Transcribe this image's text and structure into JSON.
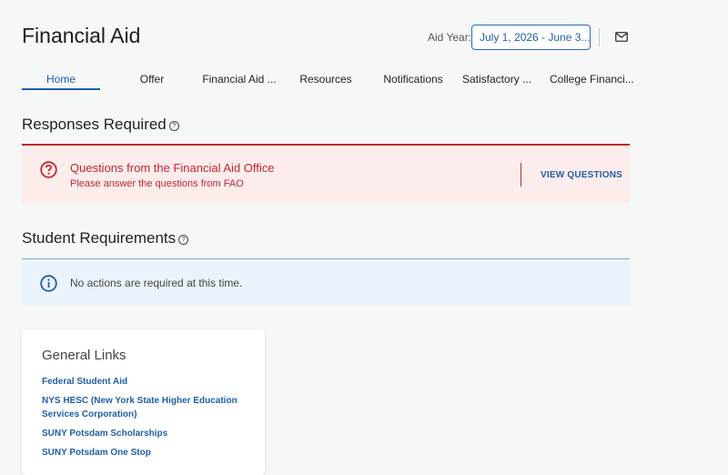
{
  "header": {
    "title": "Financial Aid",
    "aid_year_label": "Aid Year:",
    "aid_year_value": "July 1, 2026 - June 3...",
    "mail_icon": "envelope-icon"
  },
  "tabs": [
    {
      "label": "Home",
      "active": true
    },
    {
      "label": "Offer",
      "active": false
    },
    {
      "label": "Financial Aid ...",
      "active": false
    },
    {
      "label": "Resources",
      "active": false
    },
    {
      "label": "Notifications",
      "active": false
    },
    {
      "label": "Satisfactory ...",
      "active": false
    },
    {
      "label": "College Financi...",
      "active": false
    }
  ],
  "responses": {
    "title": "Responses Required",
    "alert": {
      "headline": "Questions from the Financial Aid Office",
      "subtext": "Please answer the questions from FAO",
      "action": "VIEW QUESTIONS",
      "color": "#c2272d"
    }
  },
  "requirements": {
    "title": "Student Requirements",
    "info_text": "No actions are required at this time."
  },
  "general_links": {
    "title": "General Links",
    "links": [
      "Federal Student Aid",
      "NYS HESC (New York State Higher Education Services Corporation)",
      "SUNY Potsdam Scholarships",
      "SUNY Potsdam One Stop"
    ]
  },
  "colors": {
    "accent": "#1f5fa8",
    "error": "#c2272d",
    "error_bg": "#fdecec",
    "info_bg": "#eaf3fb",
    "page_bg": "#f6f7f7"
  }
}
